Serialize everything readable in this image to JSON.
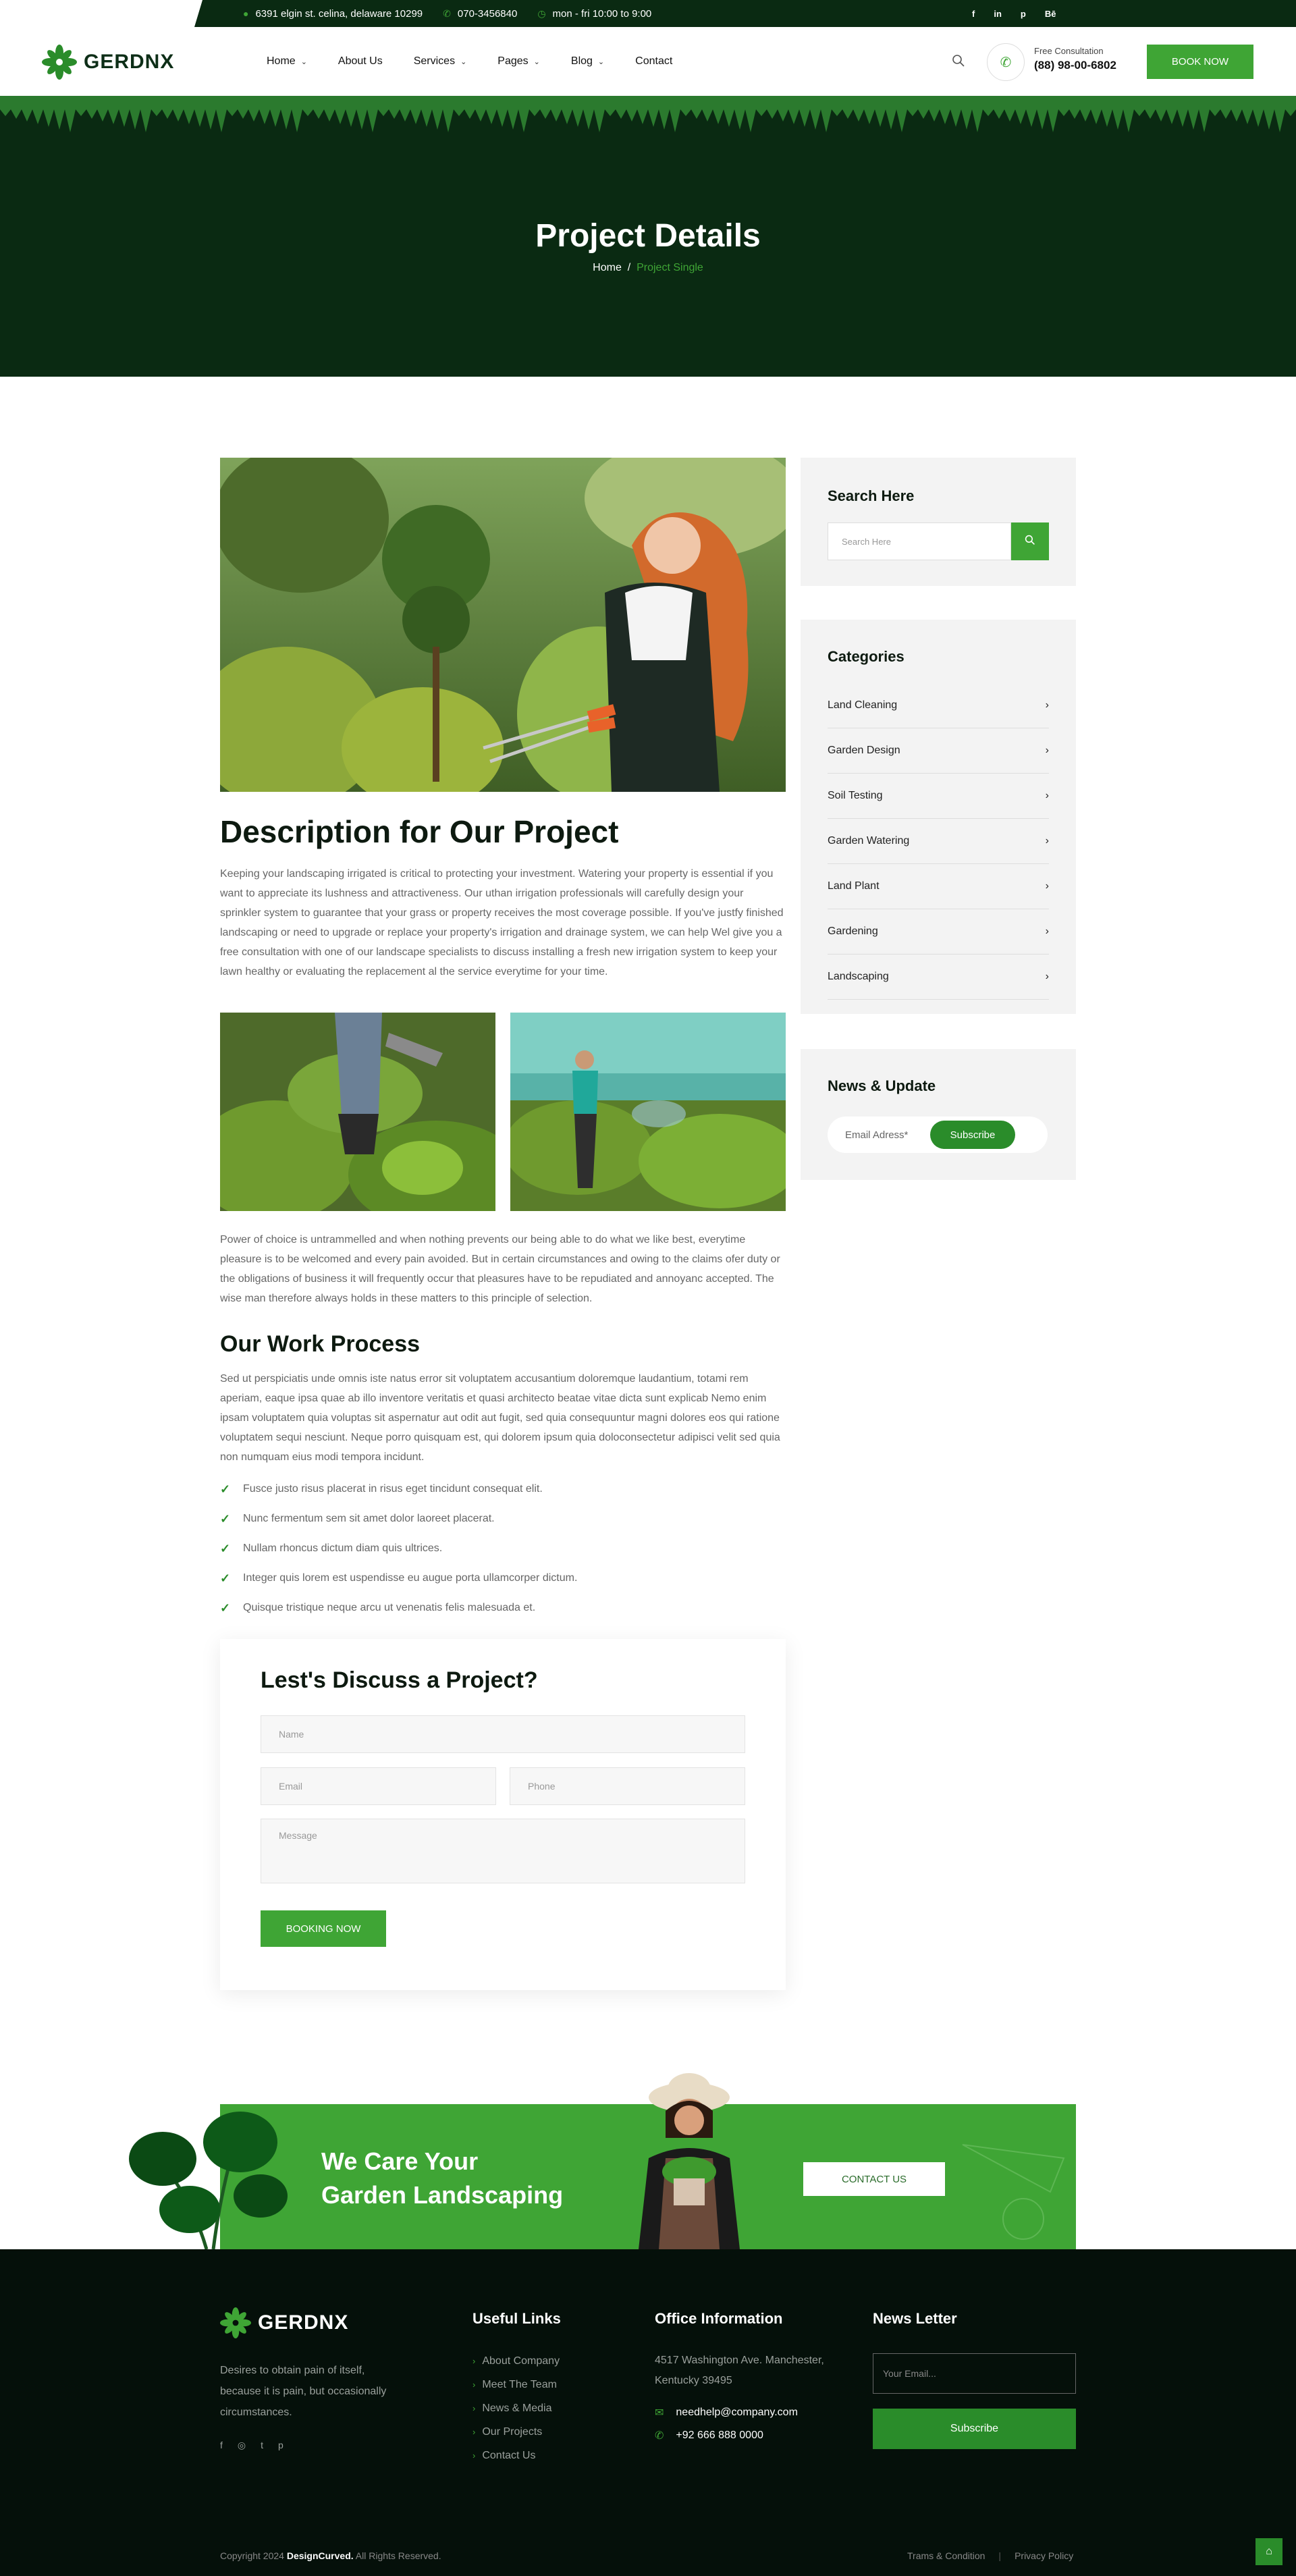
{
  "topbar": {
    "address": "6391 elgin st. celina, delaware 10299",
    "phone": "070-3456840",
    "hours": "mon - fri 10:00 to 9:00",
    "social": [
      "f",
      "in",
      "p",
      "Bē"
    ]
  },
  "header": {
    "logo": "GERDNX",
    "nav": [
      {
        "label": "Home",
        "dropdown": true
      },
      {
        "label": "About Us",
        "dropdown": false
      },
      {
        "label": "Services",
        "dropdown": true
      },
      {
        "label": "Pages",
        "dropdown": true
      },
      {
        "label": "Blog",
        "dropdown": true
      },
      {
        "label": "Contact",
        "dropdown": false
      }
    ],
    "consult_label": "Free Consultation",
    "consult_phone": "(88) 98-00-6802",
    "book_label": "BOOK NOW"
  },
  "hero": {
    "title": "Project Details",
    "breadcrumb_home": "Home",
    "breadcrumb_sep": "/",
    "breadcrumb_current": "Project Single"
  },
  "content": {
    "desc_title": "Description for Our Project",
    "desc_text": "Keeping your landscaping irrigated is critical to protecting your investment. Watering your property is essential if you want to appreciate its lushness and attractiveness. Our uthan irrigation professionals will carefully design your sprinkler system to guarantee that your grass or property receives the most coverage possible. If you've justfy finished landscaping or need to upgrade or replace your property's irrigation and drainage system, we can help Wel give you a free consultation with one of our landscape specialists to discuss installing a fresh new irrigation system to keep your lawn healthy or evaluating the replacement al the service everytime for your time.",
    "para2": "Power of choice is untrammelled and when nothing prevents our being able to do what we like best, everytime pleasure is to be welcomed and every pain avoided. But in certain circumstances and owing to the claims ofer duty or the obligations of business it will frequently occur that pleasures have to be repudiated and annoyanc accepted. The wise man therefore always holds in these matters to this principle of selection.",
    "work_title": "Our Work Process",
    "work_text": "Sed ut perspiciatis unde omnis iste natus error sit voluptatem accusantium doloremque laudantium, totami rem aperiam, eaque ipsa quae ab illo inventore veritatis et quasi architecto beatae vitae dicta sunt explicab Nemo enim ipsam voluptatem quia voluptas sit aspernatur aut odit aut fugit, sed quia consequuntur magni dolores eos qui ratione voluptatem sequi nesciunt. Neque porro quisquam est, qui dolorem ipsum quia doloconsectetur adipisci velit sed quia non numquam eius modi tempora incidunt.",
    "checklist": [
      "Fusce justo risus placerat in risus eget tincidunt consequat elit.",
      "Nunc fermentum sem sit amet dolor laoreet placerat.",
      "Nullam rhoncus dictum diam quis ultrices.",
      "Integer quis lorem est uspendisse eu augue porta ullamcorper dictum.",
      "Quisque tristique neque arcu ut venenatis felis malesuada et."
    ]
  },
  "form": {
    "title": "Lest's Discuss a Project?",
    "name_placeholder": "Name",
    "email_placeholder": "Email",
    "phone_placeholder": "Phone",
    "message_placeholder": "Message",
    "submit_label": "BOOKING NOW"
  },
  "sidebar": {
    "search_title": "Search Here",
    "search_placeholder": "Search Here",
    "categories_title": "Categories",
    "categories": [
      "Land Cleaning",
      "Garden Design",
      "Soil Testing",
      "Garden Watering",
      "Land Plant",
      "Gardening",
      "Landscaping"
    ],
    "news_title": "News & Update",
    "news_placeholder": "Email Adress*",
    "news_button": "Subscribe"
  },
  "cta": {
    "line1": "We Care Your",
    "line2": "Garden Landscaping",
    "button": "CONTACT US"
  },
  "footer": {
    "logo": "GERDNX",
    "description": "Desires to obtain pain of itself, because it is pain, but occasionally circumstances.",
    "social": [
      "f",
      "◎",
      "t",
      "p"
    ],
    "links_title": "Useful Links",
    "links": [
      "About Company",
      "Meet The Team",
      "News & Media",
      "Our Projects",
      "Contact Us"
    ],
    "office_title": "Office Information",
    "address": "4517 Washington Ave. Manchester, Kentucky 39495",
    "email": "needhelp@company.com",
    "phone": "+92 666 888 0000",
    "newsletter_title": "News Letter",
    "newsletter_placeholder": "Your Email...",
    "newsletter_button": "Subscribe",
    "copyright_prefix": "Copyright  2024",
    "copyright_brand": "DesignCurved.",
    "copyright_suffix": "All Rights Reserved.",
    "terms": "Trams & Condition",
    "privacy": "Privacy Policy"
  },
  "colors": {
    "brand_green": "#3fa535",
    "dark_green": "#0a2a12",
    "footer_bg": "#05100a"
  }
}
